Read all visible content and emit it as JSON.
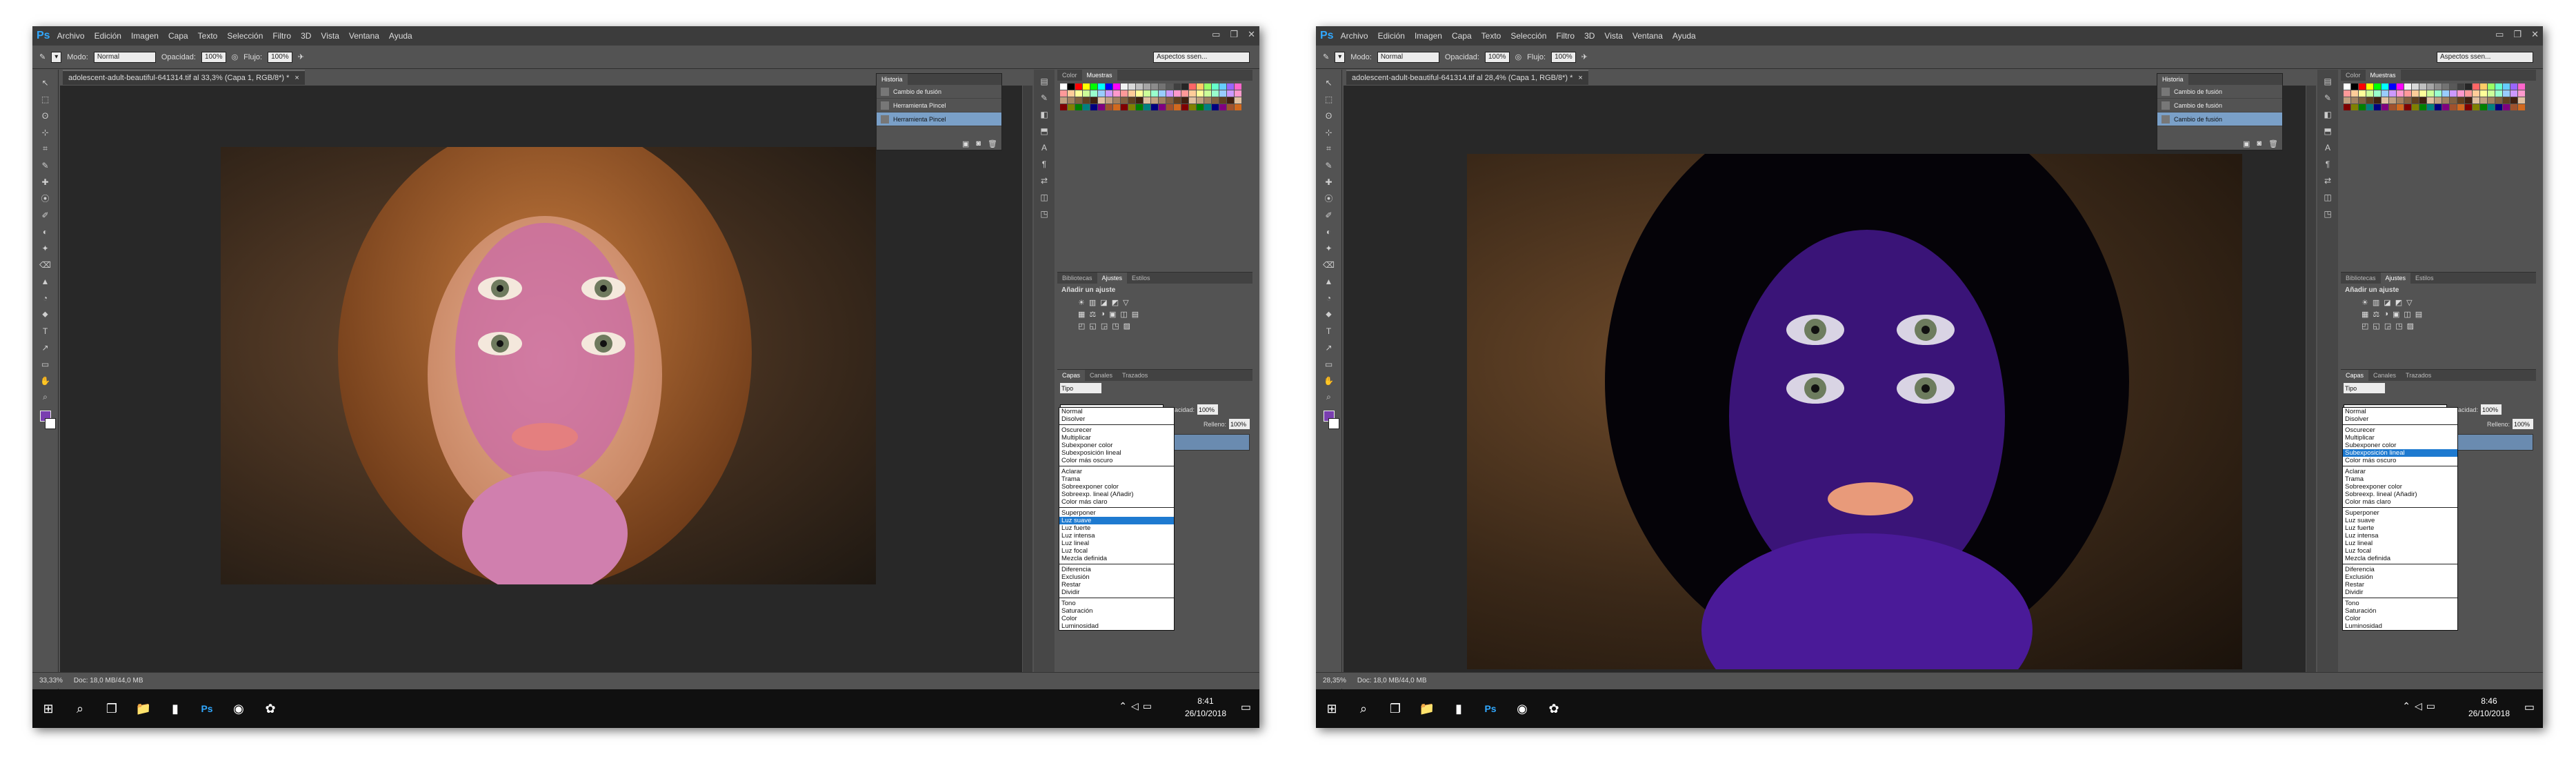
{
  "menu": [
    "Archivo",
    "Edición",
    "Imagen",
    "Capa",
    "Texto",
    "Selección",
    "Filtro",
    "3D",
    "Vista",
    "Ventana",
    "Ayuda"
  ],
  "options": {
    "mode_label": "Modo:",
    "mode_value": "Normal",
    "opacity_label": "Opacidad:",
    "opacity_value": "100%",
    "flow_label": "Flujo:",
    "flow_value": "100%",
    "workspace": "Aspectos ssen..."
  },
  "panels": {
    "tab_color": "Color",
    "tab_swatches": "Muestras",
    "tab_libraries": "Bibliotecas",
    "tab_adjust": "Ajustes",
    "tab_styles": "Estilos",
    "adj_title": "Añadir un ajuste",
    "tab_layers": "Capas",
    "tab_channels": "Canales",
    "tab_paths": "Trazados",
    "kind": "Tipo",
    "opacity_label": "Opacidad:",
    "opacity_value": "100%",
    "fill_label": "Relleno:",
    "fill_value": "100%"
  },
  "history_tab": "Historia",
  "blend_modes": [
    [
      "Normal",
      "Disolver"
    ],
    [
      "Oscurecer",
      "Multiplicar",
      "Subexponer color",
      "Subexposición lineal",
      "Color más oscuro"
    ],
    [
      "Aclarar",
      "Trama",
      "Sobreexponer color",
      "Sobreexp. lineal (Añadir)",
      "Color más claro"
    ],
    [
      "Superponer",
      "Luz suave",
      "Luz fuerte",
      "Luz intensa",
      "Luz lineal",
      "Luz focal",
      "Mezcla definida"
    ],
    [
      "Diferencia",
      "Exclusión",
      "Restar",
      "Dividir"
    ],
    [
      "Tono",
      "Saturación",
      "Color",
      "Luminosidad"
    ]
  ],
  "left": {
    "doc_title": "adolescent-adult-beautiful-641314.tif al 33,3% (Capa 1, RGB/8*) *",
    "zoom": "33,33%",
    "doc_info": "Doc: 18,0 MB/44,0 MB",
    "history": [
      "Cambio de fusión",
      "Herramienta Pincel",
      "Herramienta Pincel"
    ],
    "blend_value": "Luz suave",
    "highlight": "Luz suave",
    "clock_time": "8:41",
    "clock_date": "26/10/2018"
  },
  "right": {
    "doc_title": "adolescent-adult-beautiful-641314.tif al 28,4% (Capa 1, RGB/8*) *",
    "zoom": "28,35%",
    "doc_info": "Doc: 18,0 MB/44,0 MB",
    "history": [
      "Cambio de fusión",
      "Cambio de fusión",
      "Cambio de fusión"
    ],
    "blend_value": "Subexposición lineal",
    "highlight": "Subexposición lineal",
    "clock_time": "8:46",
    "clock_date": "26/10/2018"
  },
  "colors": {
    "ps_blue": "#31a8ff",
    "foreground": "#7a3fb0",
    "highlight": "#1e7ad0"
  }
}
